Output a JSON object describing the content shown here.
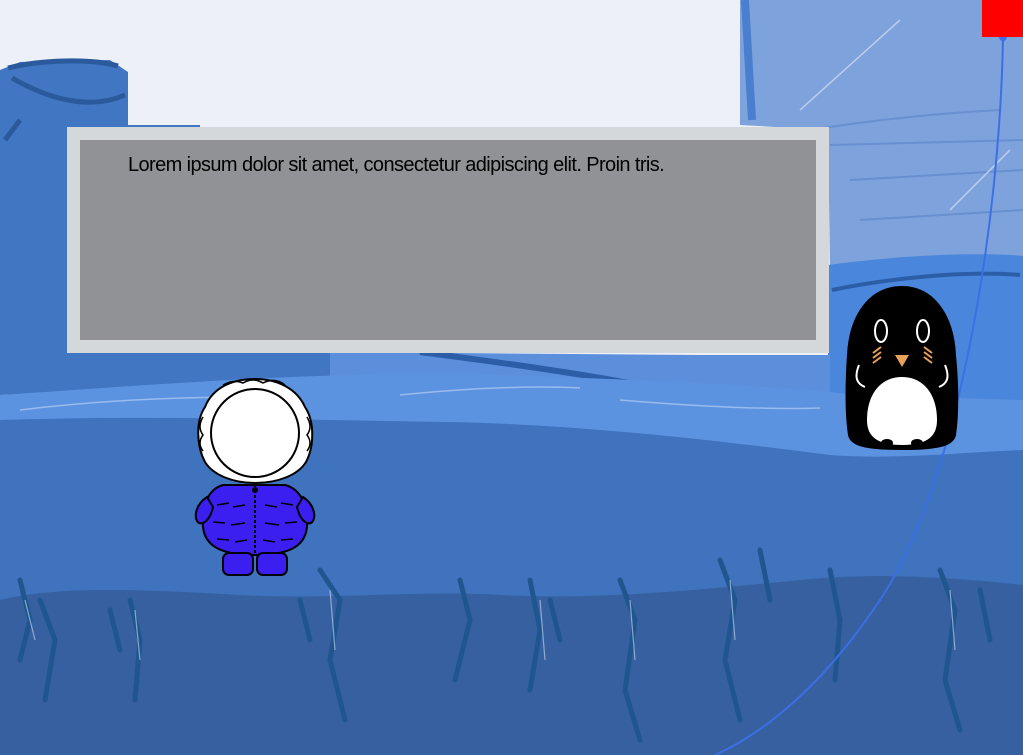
{
  "dialog": {
    "text": "Lorem ipsum dolor sit amet, consectetur adipiscing elit. Proin tris."
  },
  "colors": {
    "sky": "#eef0f8",
    "ice_light": "#5c93e0",
    "ice_mid": "#3f73bd",
    "ice_dark": "#36609f",
    "dialog_frame": "#d5d8db",
    "dialog_fill": "#909295",
    "marker": "#ff0000",
    "player_coat": "#3a1ff0",
    "curve": "#3b6fe6"
  },
  "characters": {
    "player": "child-in-blue-parka",
    "npc": "penguin"
  }
}
